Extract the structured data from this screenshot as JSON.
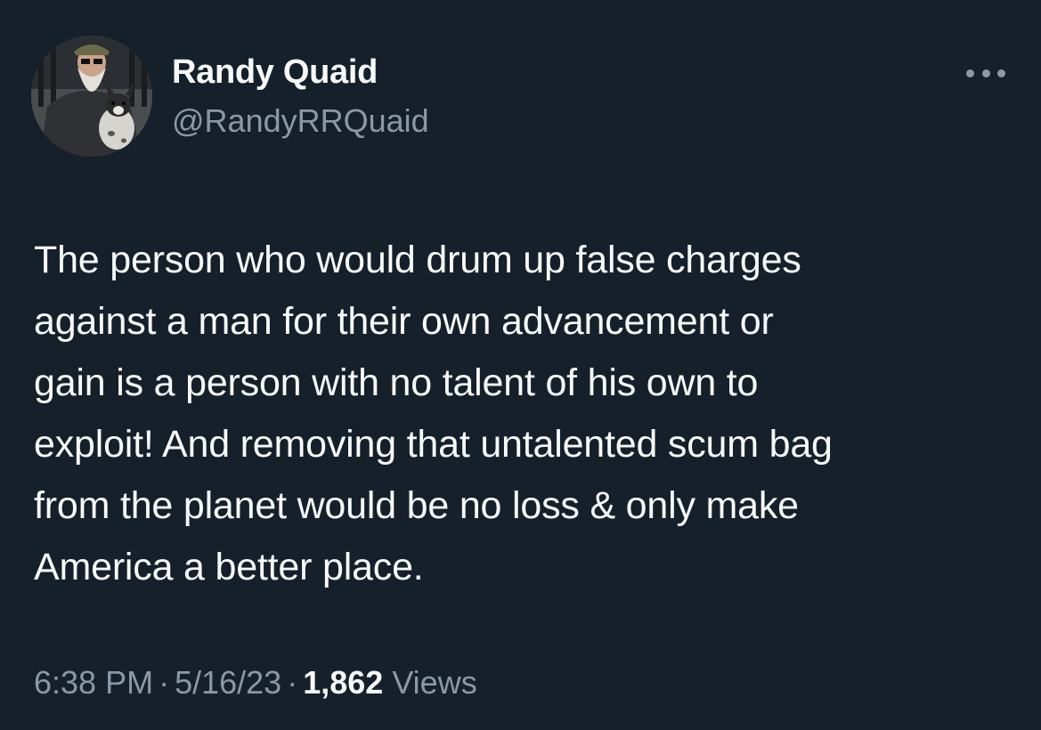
{
  "author": {
    "display_name": "Randy Quaid",
    "handle": "@RandyRRQuaid",
    "avatar_icon": "profile-photo-man-with-dog"
  },
  "more_icon": "ellipsis-icon",
  "tweet": {
    "lines": [
      "The person who would drum up false charges",
      "against a man for their own advancement or",
      "gain is a person with no talent of his own to",
      "exploit! And removing that untalented scum bag",
      "from the planet would be no loss & only make",
      "America a better place."
    ]
  },
  "meta": {
    "time": "6:38 PM",
    "separator": "·",
    "date": "5/16/23",
    "views_count": "1,862",
    "views_label": "Views"
  },
  "colors": {
    "background": "#15202b",
    "primary_text": "#f7f9f9",
    "secondary_text": "#8b98a5"
  }
}
